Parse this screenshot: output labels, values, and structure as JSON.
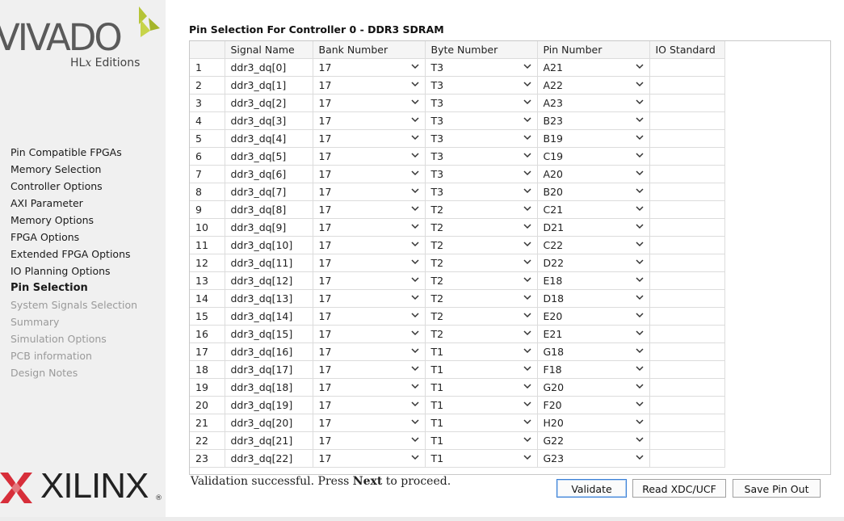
{
  "brand": {
    "vivado": "VIVADO",
    "hlx_prefix": "HL",
    "hlx_x": "x",
    "hlx_suffix": " Editions",
    "xilinx": "XILINX",
    "reg": "®",
    "vivado_leaf_color": "#b5c436",
    "xilinx_red": "#d72e3a"
  },
  "steps": [
    {
      "label": "Pin Compatible FPGAs",
      "state": "done"
    },
    {
      "label": "Memory Selection",
      "state": "done"
    },
    {
      "label": "Controller Options",
      "state": "done"
    },
    {
      "label": "AXI Parameter",
      "state": "done"
    },
    {
      "label": "Memory Options",
      "state": "done"
    },
    {
      "label": "FPGA Options",
      "state": "done"
    },
    {
      "label": "Extended FPGA Options",
      "state": "done"
    },
    {
      "label": "IO Planning Options",
      "state": "done"
    },
    {
      "label": "Pin Selection",
      "state": "current"
    },
    {
      "label": "System Signals Selection",
      "state": "disabled"
    },
    {
      "label": "Summary",
      "state": "disabled"
    },
    {
      "label": "Simulation Options",
      "state": "disabled"
    },
    {
      "label": "PCB information",
      "state": "disabled"
    },
    {
      "label": "Design Notes",
      "state": "disabled"
    }
  ],
  "page_title": "Pin Selection For Controller 0 - DDR3 SDRAM",
  "table": {
    "columns": [
      "",
      "Signal Name",
      "Bank Number",
      "Byte Number",
      "Pin Number",
      "IO Standard"
    ],
    "rows": [
      [
        "1",
        "ddr3_dq[0]",
        "17",
        "T3",
        "A21",
        ""
      ],
      [
        "2",
        "ddr3_dq[1]",
        "17",
        "T3",
        "A22",
        ""
      ],
      [
        "3",
        "ddr3_dq[2]",
        "17",
        "T3",
        "A23",
        ""
      ],
      [
        "4",
        "ddr3_dq[3]",
        "17",
        "T3",
        "B23",
        ""
      ],
      [
        "5",
        "ddr3_dq[4]",
        "17",
        "T3",
        "B19",
        ""
      ],
      [
        "6",
        "ddr3_dq[5]",
        "17",
        "T3",
        "C19",
        ""
      ],
      [
        "7",
        "ddr3_dq[6]",
        "17",
        "T3",
        "A20",
        ""
      ],
      [
        "8",
        "ddr3_dq[7]",
        "17",
        "T3",
        "B20",
        ""
      ],
      [
        "9",
        "ddr3_dq[8]",
        "17",
        "T2",
        "C21",
        ""
      ],
      [
        "10",
        "ddr3_dq[9]",
        "17",
        "T2",
        "D21",
        ""
      ],
      [
        "11",
        "ddr3_dq[10]",
        "17",
        "T2",
        "C22",
        ""
      ],
      [
        "12",
        "ddr3_dq[11]",
        "17",
        "T2",
        "D22",
        ""
      ],
      [
        "13",
        "ddr3_dq[12]",
        "17",
        "T2",
        "E18",
        ""
      ],
      [
        "14",
        "ddr3_dq[13]",
        "17",
        "T2",
        "D18",
        ""
      ],
      [
        "15",
        "ddr3_dq[14]",
        "17",
        "T2",
        "E20",
        ""
      ],
      [
        "16",
        "ddr3_dq[15]",
        "17",
        "T2",
        "E21",
        ""
      ],
      [
        "17",
        "ddr3_dq[16]",
        "17",
        "T1",
        "G18",
        ""
      ],
      [
        "18",
        "ddr3_dq[17]",
        "17",
        "T1",
        "F18",
        ""
      ],
      [
        "19",
        "ddr3_dq[18]",
        "17",
        "T1",
        "G20",
        ""
      ],
      [
        "20",
        "ddr3_dq[19]",
        "17",
        "T1",
        "F20",
        ""
      ],
      [
        "21",
        "ddr3_dq[20]",
        "17",
        "T1",
        "H20",
        ""
      ],
      [
        "22",
        "ddr3_dq[21]",
        "17",
        "T1",
        "G22",
        ""
      ],
      [
        "23",
        "ddr3_dq[22]",
        "17",
        "T1",
        "G23",
        ""
      ]
    ]
  },
  "status": {
    "pre": "Validation successful. Press ",
    "bold": "Next",
    "post": " to proceed."
  },
  "buttons": {
    "validate": "Validate",
    "read": "Read XDC/UCF",
    "save": "Save Pin Out"
  },
  "icons": {
    "dropdown": "chevron-down-icon",
    "scroll_up": "chevron-up-icon",
    "scroll_down": "chevron-down-icon"
  }
}
